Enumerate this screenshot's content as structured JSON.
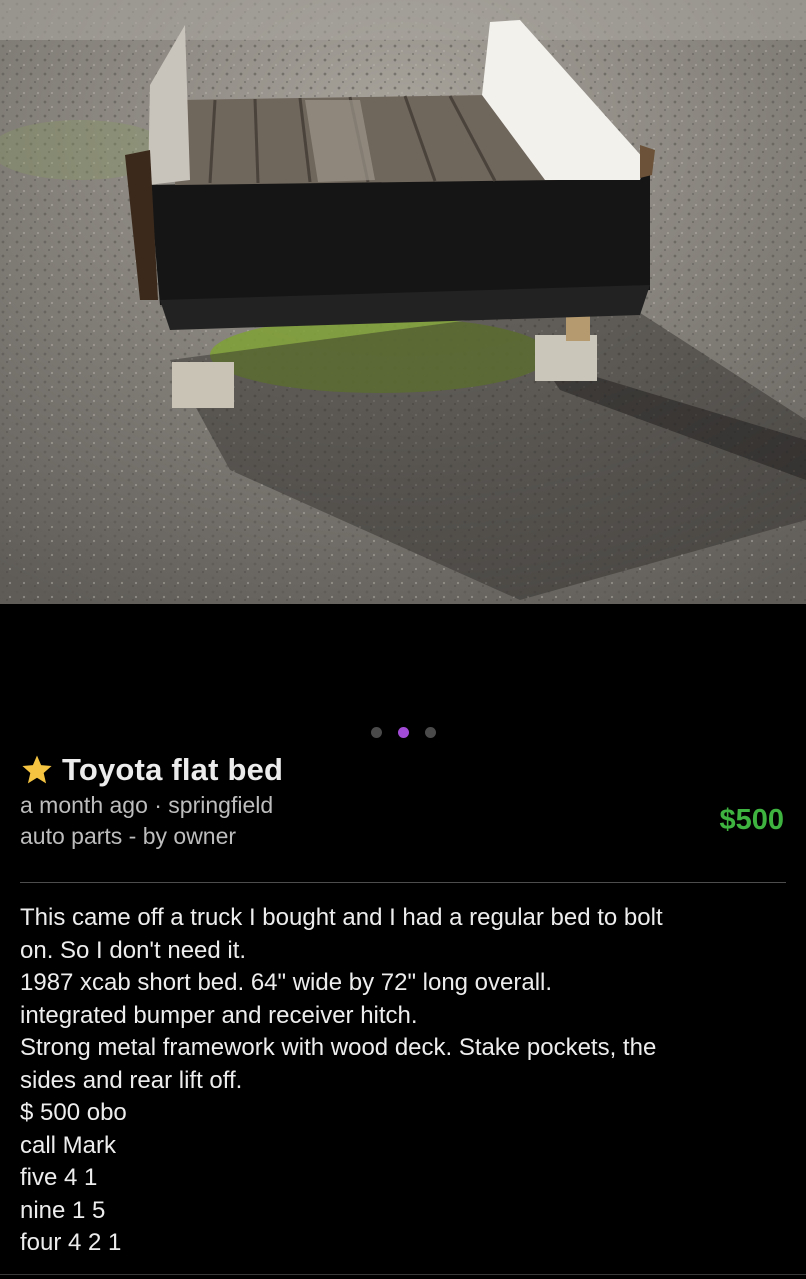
{
  "photo": {
    "alt_subject": "truck-flatbed-photo",
    "carousel": {
      "count": 3,
      "active_index": 1,
      "active_color": "#a24bd6",
      "inactive_color": "#4a4a4a"
    }
  },
  "listing": {
    "favorite_icon": "star-icon",
    "title": "Toyota flat bed",
    "meta_line1": "a month ago · springfield",
    "meta_line2": "auto parts - by owner",
    "price": "$500",
    "price_color": "#3fb33f",
    "description_lines": [
      "This came off a truck I bought and I had a regular bed to bolt",
      "on. So I don't need it.",
      "1987 xcab short bed. 64\" wide by 72\" long overall.",
      "integrated bumper and receiver hitch.",
      "Strong metal framework with wood deck. Stake pockets, the",
      "sides and rear lift off.",
      "$ 500 obo",
      "call Mark",
      "five 4 1",
      "nine 1 5",
      "four 4 2 1"
    ]
  }
}
